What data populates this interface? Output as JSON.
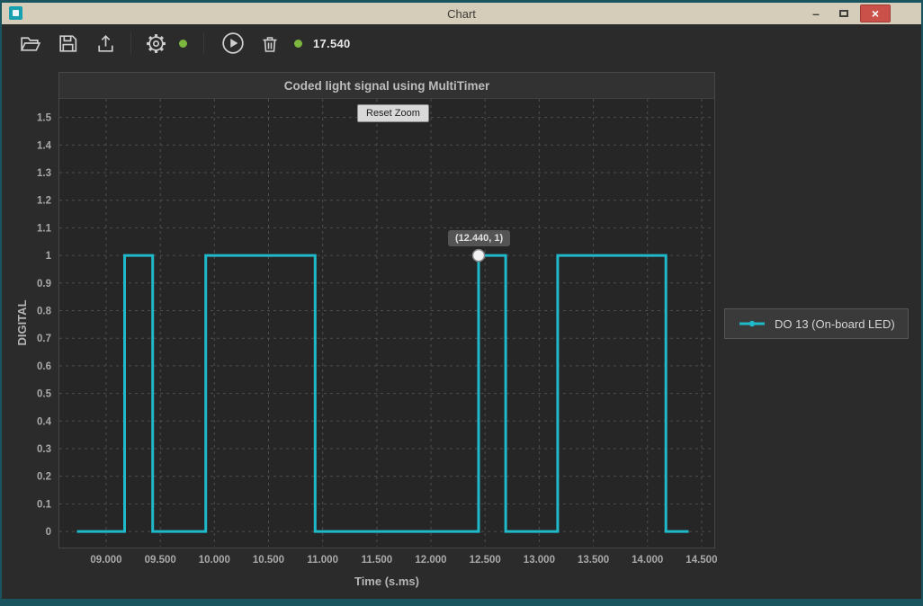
{
  "window": {
    "title": "Chart",
    "icons": {
      "minimize": "–",
      "close": "×"
    }
  },
  "toolbar": {
    "value": "17.540",
    "icons": [
      "open-file",
      "save",
      "export",
      "settings",
      "status-dot",
      "play",
      "delete",
      "status-dot"
    ]
  },
  "chart": {
    "reset_zoom_label": "Reset Zoom"
  },
  "chart_data": {
    "type": "line",
    "title": "Coded light signal using MultiTimer",
    "xlabel": "Time (s.ms)",
    "ylabel": "DIGITAL",
    "legend": [
      "DO 13 (On-board LED)"
    ],
    "legend_position": "right",
    "grid": true,
    "xlim": [
      8.568,
      14.617
    ],
    "ylim": [
      -0.055,
      1.567
    ],
    "x_ticks": [
      9,
      9.5,
      10,
      10.5,
      11,
      11.5,
      12,
      12.5,
      13,
      13.5,
      14,
      14.5
    ],
    "x_tick_labels": [
      "09.000",
      "09.500",
      "10.000",
      "10.500",
      "11.000",
      "11.500",
      "12.000",
      "12.500",
      "13.000",
      "13.500",
      "14.000",
      "14.500"
    ],
    "y_ticks": [
      0,
      0.1,
      0.2,
      0.3,
      0.4,
      0.5,
      0.6,
      0.7,
      0.8,
      0.9,
      1,
      1.1,
      1.2,
      1.3,
      1.4,
      1.5
    ],
    "y_tick_labels": [
      "0",
      "0.1",
      "0.2",
      "0.3",
      "0.4",
      "0.5",
      "0.6",
      "0.7",
      "0.8",
      "0.9",
      "1",
      "1.1",
      "1.2",
      "1.3",
      "1.4",
      "1.5"
    ],
    "series": [
      {
        "name": "DO 13 (On-board LED)",
        "color": "#1fb9c9",
        "points": [
          [
            8.73,
            0
          ],
          [
            9.17,
            0
          ],
          [
            9.17,
            1
          ],
          [
            9.43,
            1
          ],
          [
            9.43,
            0
          ],
          [
            9.92,
            0
          ],
          [
            9.92,
            1
          ],
          [
            10.93,
            1
          ],
          [
            10.93,
            0
          ],
          [
            12.44,
            0
          ],
          [
            12.44,
            1
          ],
          [
            12.69,
            1
          ],
          [
            12.69,
            0
          ],
          [
            13.17,
            0
          ],
          [
            13.17,
            1
          ],
          [
            14.17,
            1
          ],
          [
            14.17,
            0
          ],
          [
            14.38,
            0
          ]
        ]
      }
    ],
    "cursor_marker": {
      "x": 12.44,
      "y": 1,
      "label": "(12.440, 1)"
    }
  },
  "colors": {
    "accent": "#1fb9c9",
    "status_green": "#7cb63e",
    "close_red": "#c9514a",
    "titlebar": "#d5ccb9",
    "frame": "#1a545f"
  }
}
